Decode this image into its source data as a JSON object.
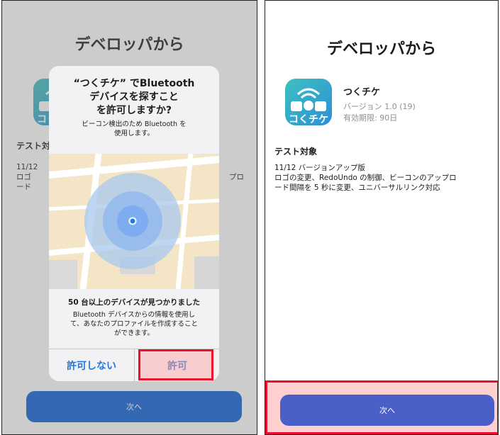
{
  "left": {
    "title": "デベロッパから",
    "section_title": "テスト対象",
    "notes_fragment": "11/12\nロゴ\nード",
    "notes_right_fragment": "プロ",
    "next_label": "次へ",
    "alert": {
      "title": "“つくチケ” でBluetooth\nデバイスを探すこと\nを許可しますか?",
      "message": "ビーコン検出のため Bluetooth を\n使用します。",
      "found_title": "50 台以上のデバイスが見つかりました",
      "found_message": "Bluetooth デバイスからの情報を使用し\nて、あなたのプロファイルを作成すること\nができます。",
      "deny_label": "許可しない",
      "allow_label": "許可"
    }
  },
  "right": {
    "title": "デベロッパから",
    "app": {
      "name": "つくチケ",
      "version": "バージョン 1.0 (19)",
      "expiry": "有効期限: 90日"
    },
    "section_title": "テスト対象",
    "notes": "11/12 バージョンアップ版\nロゴの変更、RedoUndo の制御、ビーコンのアップロ\nード間隔を 5 秒に変更、ユニバーサルリンク対応",
    "next_label": "次へ"
  },
  "colors": {
    "icon_gradient": [
      "#3fc1c0",
      "#2b8fd6"
    ],
    "next_button_left": "#0b5ed7",
    "next_button_right": "#4a5fc8",
    "highlight": "#e8102a",
    "alert_button_text": "#1f7ae0"
  },
  "icons": [
    "app-icon",
    "location-dot-icon"
  ]
}
